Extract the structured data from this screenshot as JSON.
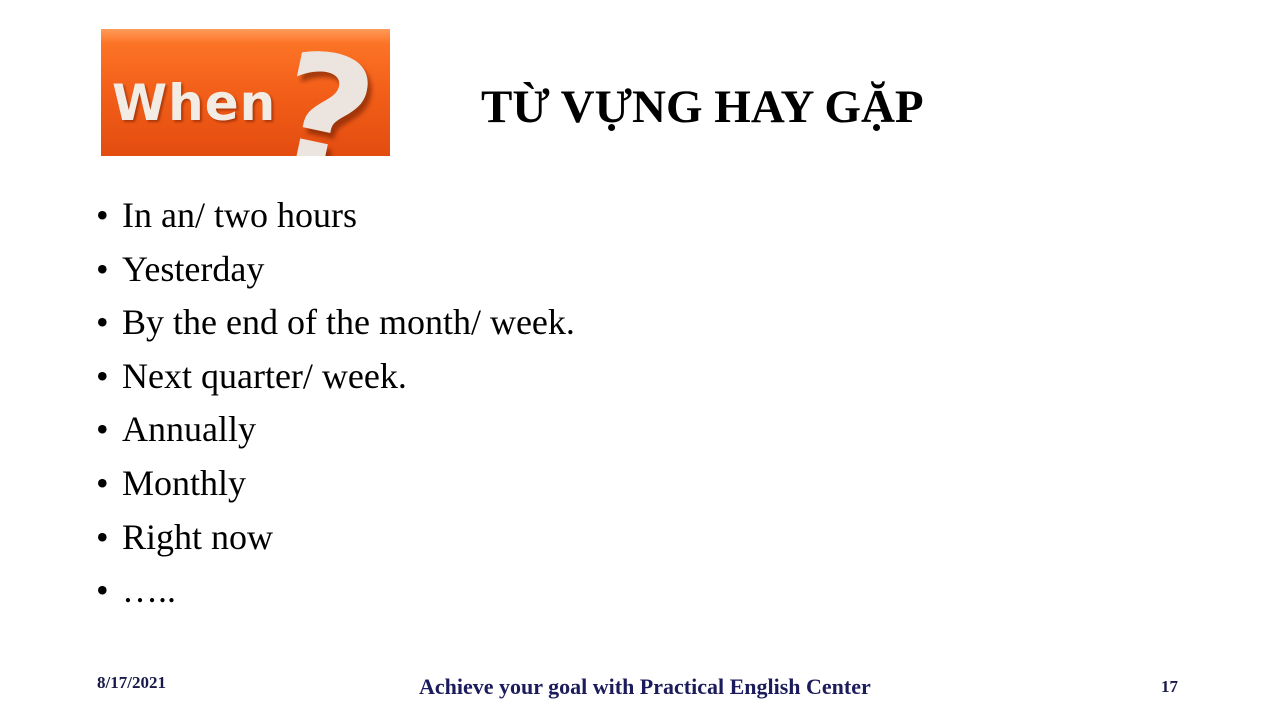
{
  "logo": {
    "word": "When",
    "mark": "?"
  },
  "title": "TỪ VỰNG HAY GẶP",
  "bullet_symbol": "•",
  "items": [
    "In an/ two hours",
    "Yesterday",
    "By the end of the month/ week.",
    "Next quarter/ week.",
    "Annually",
    "Monthly",
    "Right now",
    "….."
  ],
  "footer": {
    "date": "8/17/2021",
    "center": "Achieve your goal with Practical English Center",
    "page": "17"
  }
}
